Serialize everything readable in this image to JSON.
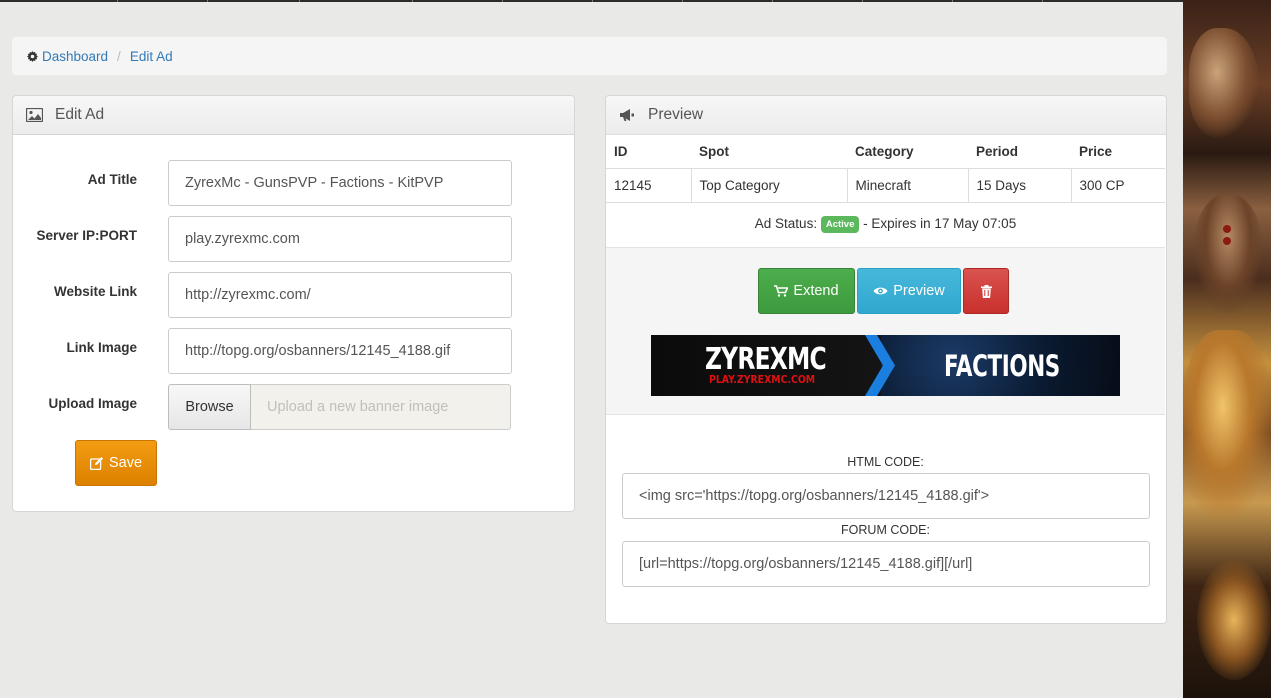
{
  "breadcrumb": {
    "home": "Dashboard",
    "current": "Edit Ad"
  },
  "edit_panel": {
    "title": "Edit Ad",
    "fields": {
      "ad_title": {
        "label": "Ad Title",
        "value": "ZyrexMc - GunsPVP - Factions - KitPVP"
      },
      "server_ip": {
        "label": "Server IP:PORT",
        "value": "play.zyrexmc.com"
      },
      "website_link": {
        "label": "Website Link",
        "value": "http://zyrexmc.com/"
      },
      "link_image": {
        "label": "Link Image",
        "value": "http://topg.org/osbanners/12145_4188.gif"
      },
      "upload_image": {
        "label": "Upload Image",
        "button": "Browse",
        "placeholder": "Upload a new banner image"
      }
    },
    "save_label": "Save"
  },
  "preview_panel": {
    "title": "Preview",
    "table": {
      "headers": [
        "ID",
        "Spot",
        "Category",
        "Period",
        "Price"
      ],
      "row": [
        "12145",
        "Top Category",
        "Minecraft",
        "15 Days",
        "300 CP"
      ]
    },
    "status": {
      "prefix": "Ad Status:",
      "badge": "Active",
      "suffix": "- Expires in 17 May 07:05"
    },
    "buttons": {
      "extend": "Extend",
      "preview": "Preview"
    },
    "banner": {
      "left_text": "ZYREXMC",
      "sub_text": "PLAY.ZYREXMC.COM",
      "right_text": "FACTIONS"
    },
    "html_code": {
      "label": "HTML CODE:",
      "value": "<img src='https://topg.org/osbanners/12145_4188.gif'>"
    },
    "forum_code": {
      "label": "FORUM CODE:",
      "value": "[url=https://topg.org/osbanners/12145_4188.gif][/url]"
    }
  },
  "colors": {
    "link": "#337ab7",
    "success": "#449d44",
    "info": "#31b0d5",
    "danger": "#c9302c",
    "warning": "#f0ad4e"
  }
}
